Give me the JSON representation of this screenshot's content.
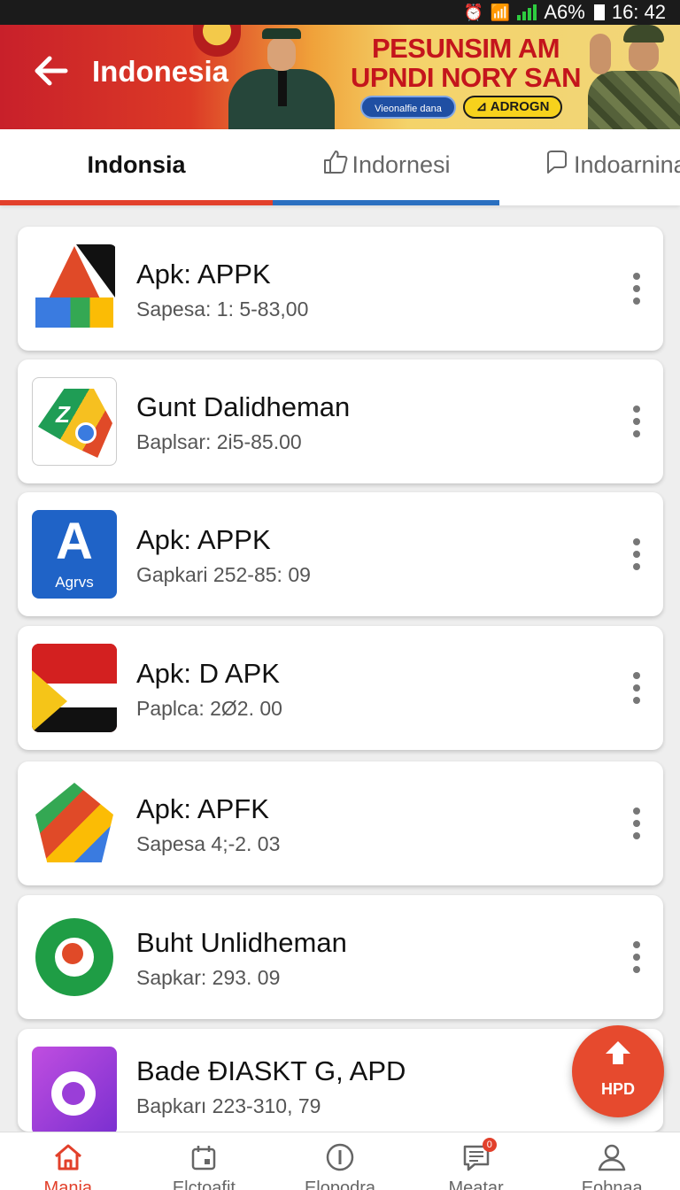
{
  "status_bar": {
    "battery": "A6%",
    "time": "16: 42"
  },
  "header": {
    "title": "Indonesia",
    "banner": {
      "headline_line1": "PESUNSIM AM",
      "headline_line2": "UPNDI NORY SAN",
      "button_primary": "Vieonalfie dana",
      "button_secondary": "⊿ ADROGN"
    }
  },
  "tabs": [
    {
      "label": "Indonsia",
      "active": true
    },
    {
      "label": "Indornesi",
      "active": false
    },
    {
      "label": "Indoarnina",
      "active": false
    }
  ],
  "apps": [
    {
      "name": "Apk: APPK",
      "meta": "Sapesa: 1: 5-83,00",
      "icon": "triangle-a-app-icon"
    },
    {
      "name": "Gunt Dalidheman",
      "meta": "Baplsar: 2i5-85.00",
      "icon": "map-pin-app-icon"
    },
    {
      "name": "Apk: APPK",
      "meta": "Gapkari 252-85: 09",
      "icon": "blue-a-app-icon",
      "icon_text": "Agrvs"
    },
    {
      "name": "Apk: D APK",
      "meta": "Paplca: 2Ø2. 00",
      "icon": "flag-app-icon"
    },
    {
      "name": "Apk: APFK",
      "meta": "Sapesa 4;-2. 03",
      "icon": "colorful-triangle-app-icon"
    },
    {
      "name": "Buht Unlidheman",
      "meta": "Sapkar: 293. 09",
      "icon": "green-circle-app-icon"
    },
    {
      "name": "Bade ÐIASKT G, APD",
      "meta": "Bapkarı 223-310, 79",
      "icon": "purple-music-app-icon"
    }
  ],
  "fab": {
    "label": "HPD",
    "icon": "upload-arrow-icon"
  },
  "bottom_nav": [
    {
      "label": "Manja",
      "icon": "home-icon",
      "active": true
    },
    {
      "label": "Elctoafit",
      "icon": "calendar-icon",
      "active": false
    },
    {
      "label": "Elopodra",
      "icon": "info-circle-icon",
      "active": false
    },
    {
      "label": "Meatar",
      "icon": "message-icon",
      "active": false,
      "badge": "0"
    },
    {
      "label": "Eobnaa",
      "icon": "person-icon",
      "active": false
    }
  ],
  "colors": {
    "accent_red": "#e2402b",
    "accent_blue": "#2a6fc0",
    "fab": "#e64a2e"
  }
}
